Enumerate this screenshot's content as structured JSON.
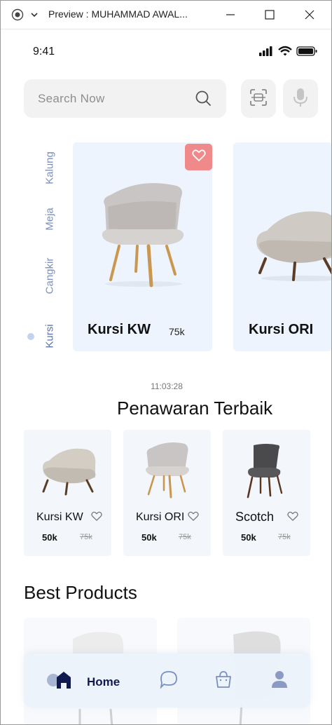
{
  "window": {
    "title": "Preview : MUHAMMAD AWAL..."
  },
  "status_bar": {
    "time": "9:41"
  },
  "search": {
    "placeholder": "Search Now"
  },
  "categories": [
    "Kalung",
    "Meja",
    "Cangkir",
    "Kursi"
  ],
  "active_category": "Kursi",
  "hero_products": [
    {
      "name": "Kursi KW",
      "price": "75k"
    },
    {
      "name": "Kursi ORI",
      "price": ""
    }
  ],
  "clock": "11:03:28",
  "offers": {
    "title": "Penawaran Terbaik",
    "items": [
      {
        "name": "Kursi KW",
        "price": "50k",
        "old_price": "75k"
      },
      {
        "name": "Kursi ORI",
        "price": "50k",
        "old_price": "75k"
      },
      {
        "name": "Scotch",
        "price": "50k",
        "old_price": "75k"
      }
    ]
  },
  "best_products": {
    "title": "Best Products"
  },
  "nav": {
    "home_label": "Home",
    "icons": [
      "home-icon",
      "chat-icon",
      "bag-icon",
      "profile-icon"
    ]
  },
  "colors": {
    "accent": "#111a4f",
    "card_bg": "#edf4fd",
    "favorite": "#f08a8a",
    "category_text": "#7b8fb8"
  }
}
